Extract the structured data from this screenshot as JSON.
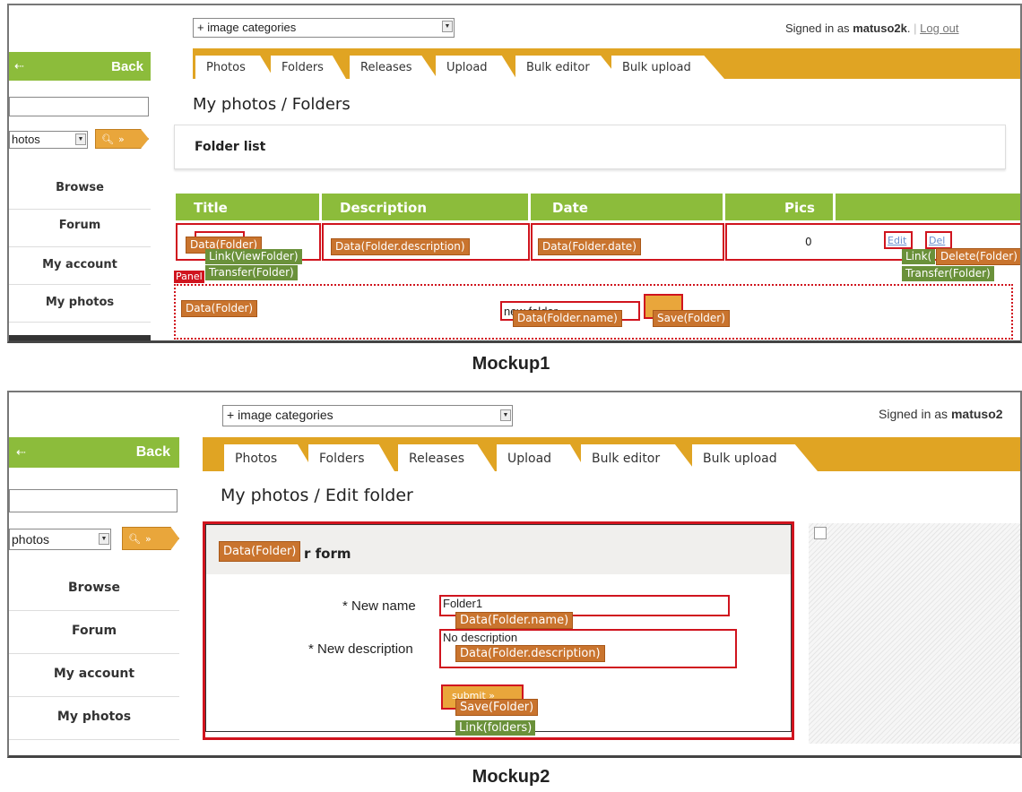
{
  "category_select": "+ image categories",
  "signed_in_prefix": "Signed in as",
  "username": "matuso2k",
  "username2": "matuso2",
  "logout": "Log out",
  "back": "Back",
  "back_arrow": "⇠",
  "search_select_m1": "hotos",
  "search_select_m2": "photos",
  "nav": [
    "Browse",
    "Forum",
    "My account",
    "My photos"
  ],
  "tabs": [
    "Photos",
    "Folders",
    "Releases",
    "Upload",
    "Bulk editor",
    "Bulk upload"
  ],
  "mockup1": {
    "page_title": "My photos / Folders",
    "folder_list": "Folder list",
    "headers": [
      "Title",
      "Description",
      "Date",
      "Pics"
    ],
    "pics_value": "0",
    "edit_link": "Edit",
    "del_link": "Del",
    "new_folder_value": "new folder",
    "panel_tag": "Panel",
    "tags": {
      "title_data": "Data(Folder)",
      "link_view": "Link(ViewFolder)",
      "transfer": "Transfer(Folder)",
      "desc_data": "Data(Folder.description)",
      "date_data": "Data(Folder.date)",
      "link_edit": "Link(",
      "delete": "Delete(Folder)",
      "transfer2": "Transfer(Folder)",
      "panel_data": "Data(Folder)",
      "name_data": "Data(Folder.name)",
      "save": "Save(Folder)"
    },
    "caption": "Mockup1"
  },
  "mockup2": {
    "page_title": "My photos / Edit folder",
    "form_title": "r form",
    "new_name_label": "* New name",
    "new_name_value": "Folder1",
    "new_desc_label": "* New description",
    "new_desc_value": "No description",
    "submit": "submit",
    "tags": {
      "form_data": "Data(Folder)",
      "name_data": "Data(Folder.name)",
      "desc_data": "Data(Folder.description)",
      "save": "Save(Folder)",
      "link_folders": "Link(folders)"
    },
    "caption": "Mockup2"
  },
  "colors": {
    "green": "#8cbc3b",
    "orange_tab_bar": "#e0a423",
    "annotation_red": "#d0141e",
    "tag_orange": "#c9742e",
    "tag_green": "#6a913a"
  }
}
